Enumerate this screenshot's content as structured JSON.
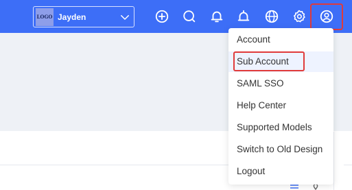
{
  "topbar": {
    "workspace": {
      "logo_text": "LOGO",
      "name": "Jayden"
    },
    "icons": [
      "add-circle-icon",
      "search-icon",
      "bell-icon",
      "notification-icon",
      "globe-icon",
      "settings-icon",
      "user-icon"
    ]
  },
  "colors": {
    "accent": "#3d6ef7",
    "highlight": "#e03a3a",
    "active_bg": "#eef3ff"
  },
  "account_menu": {
    "items": [
      {
        "label": "Account"
      },
      {
        "label": "Sub Account"
      },
      {
        "label": "SAML SSO"
      },
      {
        "label": "Help Center"
      },
      {
        "label": "Supported Models"
      },
      {
        "label": "Switch to Old Design"
      },
      {
        "label": "Logout"
      }
    ]
  }
}
